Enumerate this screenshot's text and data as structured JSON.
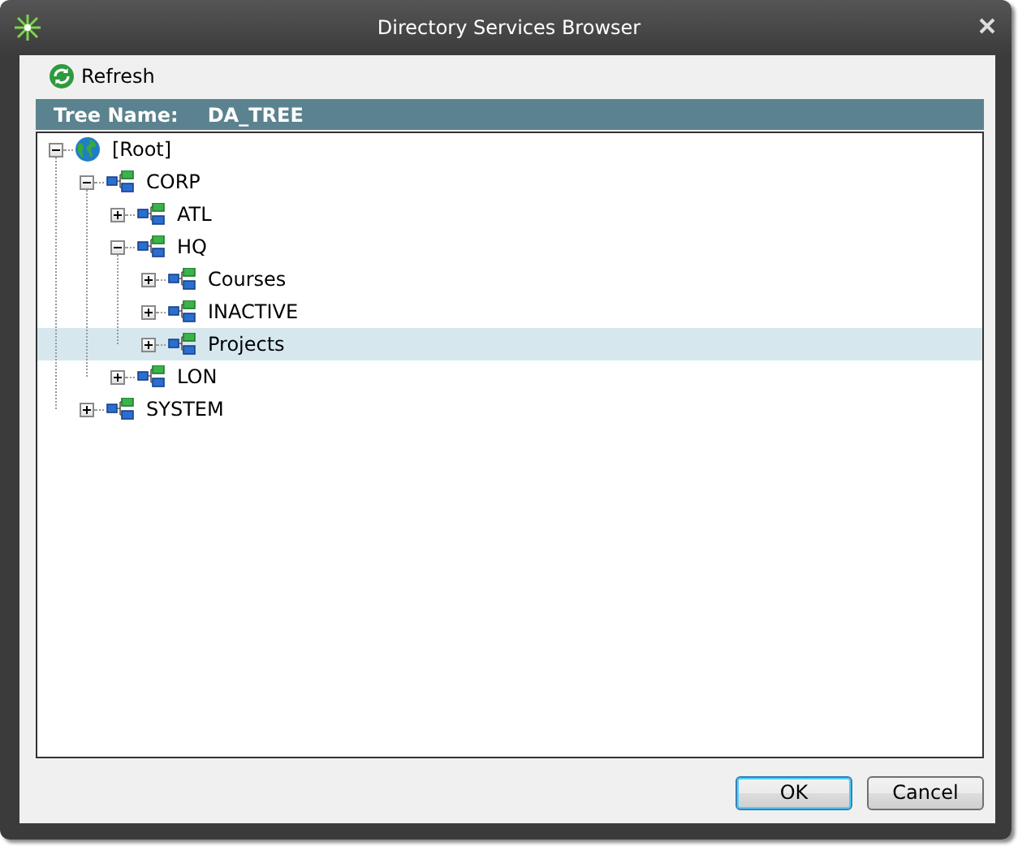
{
  "window": {
    "title": "Directory Services Browser"
  },
  "toolbar": {
    "refresh": "Refresh"
  },
  "tree_header": {
    "label": "Tree Name:",
    "value": "DA_TREE"
  },
  "tree": [
    {
      "name": "[Root]",
      "kind": "root",
      "expanded": true,
      "selected": false,
      "children": [
        {
          "name": "CORP",
          "kind": "container",
          "expanded": true,
          "selected": false,
          "children": [
            {
              "name": "ATL",
              "kind": "container",
              "expanded": false,
              "selected": false
            },
            {
              "name": "HQ",
              "kind": "container",
              "expanded": true,
              "selected": false,
              "children": [
                {
                  "name": "Courses",
                  "kind": "container",
                  "expanded": false,
                  "selected": false
                },
                {
                  "name": "INACTIVE",
                  "kind": "container",
                  "expanded": false,
                  "selected": false
                },
                {
                  "name": "Projects",
                  "kind": "container",
                  "expanded": false,
                  "selected": true
                }
              ]
            },
            {
              "name": "LON",
              "kind": "container",
              "expanded": false,
              "selected": false
            }
          ]
        },
        {
          "name": "SYSTEM",
          "kind": "container",
          "expanded": false,
          "selected": false
        }
      ]
    }
  ],
  "buttons": [
    {
      "label": "OK",
      "default": true
    },
    {
      "label": "Cancel",
      "default": false
    }
  ]
}
